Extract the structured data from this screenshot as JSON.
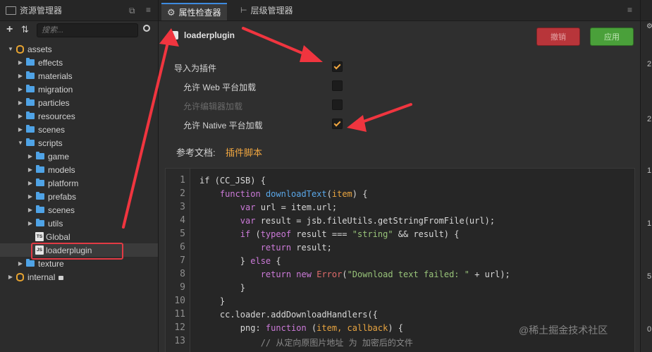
{
  "left_panel": {
    "title": "资源管理器",
    "search_placeholder": "搜索...",
    "tree": [
      {
        "label": "assets",
        "type": "db",
        "depth": 0,
        "open": true
      },
      {
        "label": "effects",
        "type": "folder",
        "depth": 1,
        "open": false
      },
      {
        "label": "materials",
        "type": "folder",
        "depth": 1,
        "open": false
      },
      {
        "label": "migration",
        "type": "folder",
        "depth": 1,
        "open": false
      },
      {
        "label": "particles",
        "type": "folder",
        "depth": 1,
        "open": false
      },
      {
        "label": "resources",
        "type": "folder",
        "depth": 1,
        "open": false
      },
      {
        "label": "scenes",
        "type": "folder",
        "depth": 1,
        "open": false
      },
      {
        "label": "scripts",
        "type": "folder",
        "depth": 1,
        "open": true
      },
      {
        "label": "game",
        "type": "folder",
        "depth": 2,
        "open": false
      },
      {
        "label": "models",
        "type": "folder",
        "depth": 2,
        "open": false
      },
      {
        "label": "platform",
        "type": "folder",
        "depth": 2,
        "open": false
      },
      {
        "label": "prefabs",
        "type": "folder",
        "depth": 2,
        "open": false
      },
      {
        "label": "scenes",
        "type": "folder",
        "depth": 2,
        "open": false
      },
      {
        "label": "utils",
        "type": "folder",
        "depth": 2,
        "open": false
      },
      {
        "label": "Global",
        "type": "ts",
        "depth": 2
      },
      {
        "label": "loaderplugin",
        "type": "js",
        "depth": 2,
        "selected": true
      },
      {
        "label": "texture",
        "type": "folder",
        "depth": 1,
        "open": false
      },
      {
        "label": "internal",
        "type": "db",
        "depth": 0,
        "open": false,
        "locked": true
      }
    ]
  },
  "tabs": {
    "inspector": "属性检查器",
    "hierarchy": "层级管理器"
  },
  "inspector": {
    "asset_name": "loaderplugin",
    "revert_label": "撤销",
    "apply_label": "应用",
    "props": [
      {
        "label": "导入为插件",
        "checked": true,
        "disabled": false,
        "indent": false
      },
      {
        "label": "允许 Web 平台加载",
        "checked": false,
        "disabled": false,
        "indent": true
      },
      {
        "label": "允许编辑器加载",
        "checked": false,
        "disabled": true,
        "indent": true
      },
      {
        "label": "允许 Native 平台加载",
        "checked": true,
        "disabled": false,
        "indent": true
      }
    ],
    "doc_label": "参考文档:",
    "doc_link": "插件脚本"
  },
  "code": {
    "lines": [
      [
        [
          "if (CC_JSB) {",
          ""
        ]
      ],
      [
        [
          "    ",
          ""
        ],
        [
          "function",
          "kw"
        ],
        [
          " ",
          ""
        ],
        [
          "downloadText",
          "fn"
        ],
        [
          "(",
          ""
        ],
        [
          "item",
          "par"
        ],
        [
          ") {",
          ""
        ]
      ],
      [
        [
          "        ",
          ""
        ],
        [
          "var",
          "kw"
        ],
        [
          " url = item.url;",
          ""
        ]
      ],
      [
        [
          "        ",
          ""
        ],
        [
          "var",
          "kw"
        ],
        [
          " result = jsb.fileUtils.getStringFromFile(url);",
          ""
        ]
      ],
      [
        [
          "        ",
          ""
        ],
        [
          "if",
          "kw"
        ],
        [
          " (",
          ""
        ],
        [
          "typeof",
          "kw"
        ],
        [
          " result === ",
          ""
        ],
        [
          "\"string\"",
          "str"
        ],
        [
          " && result) {",
          ""
        ]
      ],
      [
        [
          "            ",
          ""
        ],
        [
          "return",
          "kw"
        ],
        [
          " result;",
          ""
        ]
      ],
      [
        [
          "        } ",
          ""
        ],
        [
          "else",
          "kw"
        ],
        [
          " {",
          ""
        ]
      ],
      [
        [
          "            ",
          ""
        ],
        [
          "return",
          "kw"
        ],
        [
          " ",
          ""
        ],
        [
          "new",
          "kw"
        ],
        [
          " ",
          ""
        ],
        [
          "Error",
          "err"
        ],
        [
          "(",
          ""
        ],
        [
          "\"Download text failed: \"",
          "str"
        ],
        [
          " + url);",
          ""
        ]
      ],
      [
        [
          "        }",
          ""
        ]
      ],
      [
        [
          "    }",
          ""
        ]
      ],
      [
        [
          "    cc.loader.addDownloadHandlers({",
          ""
        ]
      ],
      [
        [
          "        png: ",
          ""
        ],
        [
          "function",
          "kw"
        ],
        [
          " (",
          ""
        ],
        [
          "item, callback",
          "par"
        ],
        [
          ") {",
          ""
        ]
      ],
      [
        [
          "            ",
          ""
        ],
        [
          "// 从定向原图片地址 为 加密后的文件",
          "cm"
        ]
      ]
    ]
  },
  "right_panel": {
    "numbers": [
      "2",
      "2",
      "1,",
      "1,",
      "5",
      "0"
    ]
  },
  "watermark": "@稀土掘金技术社区",
  "colors": {
    "accent": "#3d8be0",
    "revert": "#b8353a",
    "apply": "#4aa03a",
    "doc_link": "#f0a640",
    "annotation": "#e23a44"
  }
}
